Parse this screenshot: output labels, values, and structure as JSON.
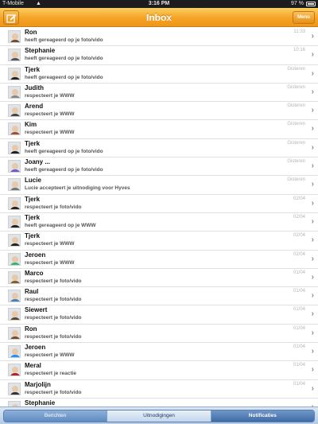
{
  "status_bar": {
    "carrier": "T-Mobile",
    "time": "3:16 PM",
    "battery": "97 %"
  },
  "nav": {
    "title": "Inbox",
    "menu_label": "Menu",
    "compose_icon": "compose-icon"
  },
  "messages": [
    {
      "name": "Ron",
      "text": "heeft gereageerd op je foto/vido",
      "date": "11:33",
      "avatar_color": "#7a4a2a"
    },
    {
      "name": "Stephanie",
      "text": "heeft gereageerd op je foto/vido",
      "date": "10:16",
      "avatar_color": "#555555"
    },
    {
      "name": "Tjerk",
      "text": "heeft gereageerd op je foto/vido",
      "date": "Gisteren",
      "avatar_color": "#222222"
    },
    {
      "name": "Judith",
      "text": "respecteert je WWW",
      "date": "Gisteren",
      "avatar_color": "#888888"
    },
    {
      "name": "Arend",
      "text": "respecteert je WWW",
      "date": "Gisteren",
      "avatar_color": "#444444"
    },
    {
      "name": "Kim",
      "text": "respecteert je WWW",
      "date": "Gisteren",
      "avatar_color": "#a0522d"
    },
    {
      "name": "Tjerk",
      "text": "heeft gereageerd op je foto/vido",
      "date": "Gisteren",
      "avatar_color": "#222222"
    },
    {
      "name": "Joany ...",
      "text": "heeft gereageerd op je foto/vido",
      "date": "Gisteren",
      "avatar_color": "#6a5acd"
    },
    {
      "name": "Lucie",
      "text": "Lucie accepteert je uitnodiging voor Hyves",
      "date": "Gisteren",
      "avatar_color": "#777777"
    },
    {
      "name": "Tjerk",
      "text": "respecteert je foto/vido",
      "date": "02/04",
      "avatar_color": "#222222"
    },
    {
      "name": "Tjerk",
      "text": "heeft gereageerd op je WWW",
      "date": "02/04",
      "avatar_color": "#222222"
    },
    {
      "name": "Tjerk",
      "text": "respecteert je WWW",
      "date": "02/04",
      "avatar_color": "#222222"
    },
    {
      "name": "Jeroen",
      "text": "respecteert je WWW",
      "date": "02/04",
      "avatar_color": "#3cb371"
    },
    {
      "name": "Marco",
      "text": "respecteert je foto/vido",
      "date": "01/04",
      "avatar_color": "#8b5a2b"
    },
    {
      "name": "Raul",
      "text": "respecteert je foto/vido",
      "date": "01/04",
      "avatar_color": "#4682b4"
    },
    {
      "name": "Siewert",
      "text": "respecteert je foto/vido",
      "date": "01/04",
      "avatar_color": "#5a4a2a"
    },
    {
      "name": "Ron",
      "text": "respecteert je foto/vido",
      "date": "01/04",
      "avatar_color": "#7a4a2a"
    },
    {
      "name": "Jeroen",
      "text": "respecteert je WWW",
      "date": "01/04",
      "avatar_color": "#1e90ff"
    },
    {
      "name": "Meral",
      "text": "respecteert je reactie",
      "date": "01/04",
      "avatar_color": "#b22222"
    },
    {
      "name": "Marjolijn",
      "text": "respecteert je foto/vido",
      "date": "01/04",
      "avatar_color": "#333333"
    },
    {
      "name": "Stephanie",
      "text": "",
      "date": "",
      "avatar_color": "#555555"
    }
  ],
  "tabs": [
    {
      "label": "Berichten"
    },
    {
      "label": "Uitnodigingen"
    },
    {
      "label": "Notificaties"
    }
  ],
  "colors": {
    "nav_orange": "#f6a326",
    "tab_active": "#3f6ba6"
  }
}
